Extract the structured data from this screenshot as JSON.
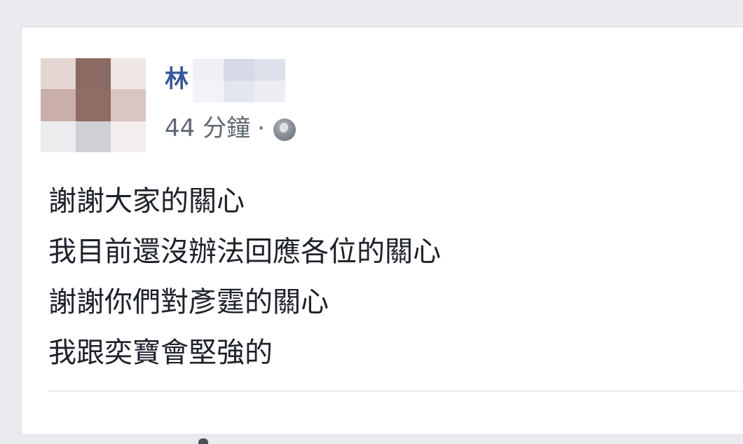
{
  "post": {
    "author_name_visible": "林",
    "timestamp": "44 分鐘",
    "separator": "·",
    "privacy_icon": "globe-icon",
    "lines": [
      "謝謝大家的關心",
      "我目前還沒辦法回應各位的關心",
      "謝謝你們對彥霆的關心",
      "我跟奕寶會堅強的"
    ]
  },
  "colors": {
    "name": "#365899",
    "meta": "#606770",
    "text": "#1d2129",
    "background": "#e9ebee"
  }
}
